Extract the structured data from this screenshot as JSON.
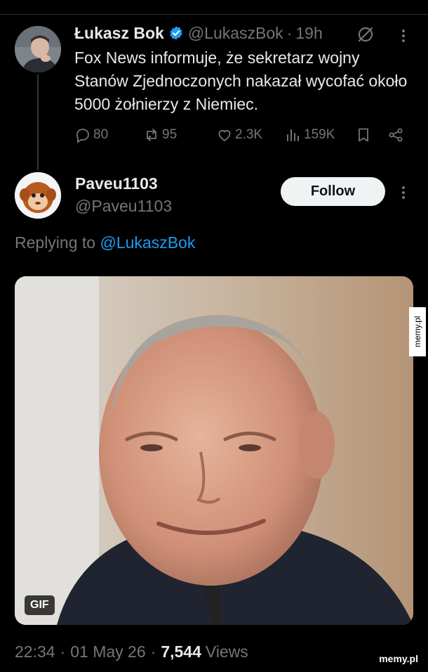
{
  "parent": {
    "name": "Łukasz Bok",
    "handle": "@LukaszBok",
    "dot": "·",
    "time": "19h",
    "text": "Fox News informuje, że sekretarz wojny Stanów Zjednoczonych nakazał wycofać około 5000 żołnierzy z Niemiec.",
    "replies": "80",
    "reposts": "95",
    "likes": "2.3K",
    "views": "159K",
    "icons": [
      "verified-badge-icon",
      "grok-icon",
      "more-icon",
      "reply-icon",
      "repost-icon",
      "like-icon",
      "views-icon",
      "bookmark-icon",
      "share-icon"
    ]
  },
  "reply": {
    "name": "Paveu1103",
    "handle": "@Paveu1103",
    "follow_label": "Follow",
    "replying_prefix": "Replying to",
    "replying_handle": "@LukaszBok",
    "media_badge": "GIF"
  },
  "meta": {
    "time": "22:34",
    "date": "01 May 26",
    "views_count": "7,544",
    "views_label": "Views",
    "dot": "·"
  },
  "watermark": {
    "side": "memy.pl",
    "corner": "memy.pl"
  },
  "colors": {
    "background": "#000000",
    "accent": "#1d9bf0",
    "muted": "#71767b",
    "text": "#e7e9ea"
  }
}
